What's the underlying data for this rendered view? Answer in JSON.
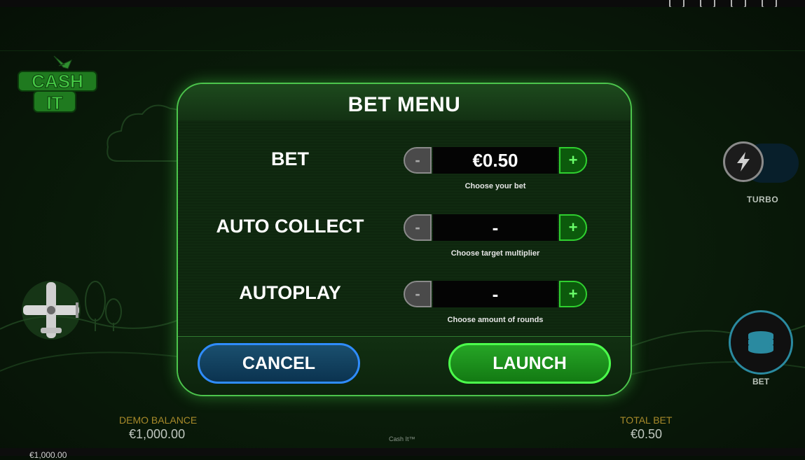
{
  "app": {
    "logo_icon": "cash-it-logo",
    "game_name": "Cash It™"
  },
  "top_bar": {
    "icons": [
      "globe-icon",
      "settings-icon",
      "sound-icon",
      "clubs-icon"
    ]
  },
  "side_controls": {
    "turbo": {
      "label": "TURBO",
      "icon": "lightning-icon"
    },
    "bet": {
      "label": "BET",
      "icon": "coin-stack-icon"
    }
  },
  "modal": {
    "title": "BET MENU",
    "rows": [
      {
        "label": "BET",
        "value": "€0.50",
        "hint": "Choose your bet",
        "minus": "-",
        "plus": "+"
      },
      {
        "label": "AUTO COLLECT",
        "value": "-",
        "hint": "Choose target multiplier",
        "minus": "-",
        "plus": "+"
      },
      {
        "label": "AUTOPLAY",
        "value": "-",
        "hint": "Choose amount of rounds",
        "minus": "-",
        "plus": "+"
      }
    ],
    "cancel_label": "CANCEL",
    "launch_label": "LAUNCH"
  },
  "footer": {
    "demo_balance_label": "DEMO BALANCE",
    "demo_balance_value": "€1,000.00",
    "total_bet_label": "TOTAL BET",
    "total_bet_value": "€0.50",
    "bottom_bar_text": "€1,000.00"
  },
  "colors": {
    "accent_green": "#4cc44c",
    "cancel_blue": "#2f8cff",
    "label_gold": "#a88a2a"
  }
}
